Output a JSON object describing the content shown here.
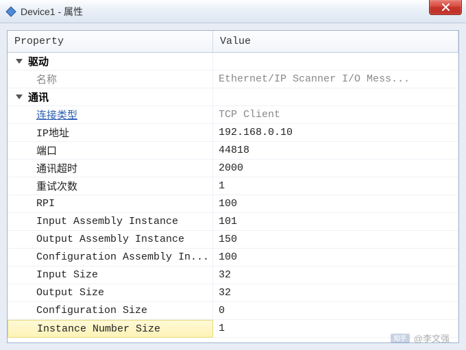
{
  "window": {
    "title": "Device1 - 属性",
    "close_label": "X"
  },
  "headers": {
    "property": "Property",
    "value": "Value"
  },
  "groups": [
    {
      "label": "驱动"
    },
    {
      "label": "通讯"
    }
  ],
  "rows": {
    "driver_name": {
      "label": "名称",
      "value": "Ethernet/IP Scanner I/O Mess..."
    },
    "conn_type": {
      "label": "连接类型",
      "value": "TCP Client"
    },
    "ip": {
      "label": "IP地址",
      "value": "192.168.0.10"
    },
    "port": {
      "label": "端口",
      "value": "44818"
    },
    "timeout": {
      "label": "通讯超时",
      "value": "2000"
    },
    "retry": {
      "label": "重试次数",
      "value": "1"
    },
    "rpi": {
      "label": "RPI",
      "value": "100"
    },
    "input_asm": {
      "label": "Input Assembly Instance",
      "value": "101"
    },
    "output_asm": {
      "label": "Output Assembly Instance",
      "value": "150"
    },
    "config_asm": {
      "label": "Configuration Assembly In...",
      "value": "100"
    },
    "input_size": {
      "label": "Input Size",
      "value": "32"
    },
    "output_size": {
      "label": "Output Size",
      "value": "32"
    },
    "config_size": {
      "label": "Configuration Size",
      "value": "0"
    },
    "inst_num_size": {
      "label": "Instance Number Size",
      "value": "1"
    }
  },
  "watermark": {
    "logo": "知乎",
    "text": "@李文强"
  }
}
